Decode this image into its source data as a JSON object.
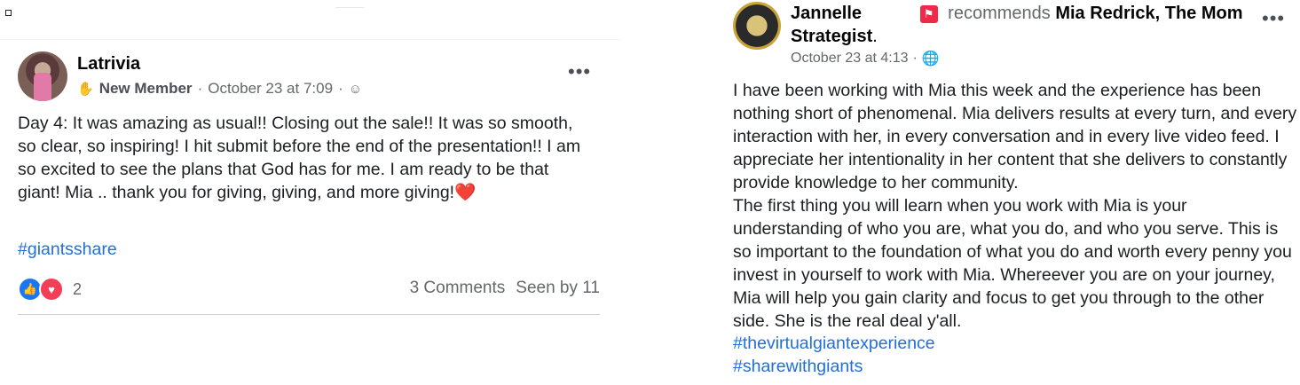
{
  "left_post": {
    "author": "Latrivia",
    "member_badge": "New Member",
    "meta_date": "October 23 at 7:09",
    "meta_separator": "·",
    "more_label": "•••",
    "body": "Day 4: It was amazing as usual!! Closing out the sale!! It was so smooth, so clear, so inspiring! I hit submit before the end of the presentation!! I am so excited to see the plans that God has for me. I am ready to be that giant! Mia .. thank you for giving, giving, and more giving!",
    "body_emoji": "❤️",
    "hashtag": "#giantsshare",
    "reaction_count": "2",
    "comments": "3 Comments",
    "seen_by": "Seen by 11",
    "icons": [
      "hand-badge-icon",
      "group-audience-icon",
      "like-reaction-icon",
      "love-reaction-icon",
      "more-options-icon"
    ]
  },
  "right_post": {
    "author": "Jannelle",
    "recommend_verb": "recommends",
    "recommend_target": "Mia Redrick, The Mom Strategist",
    "recommend_period": ".",
    "meta_date": "October 23 at 4:13",
    "meta_separator": "·",
    "more_label": "•••",
    "paragraph_1": "I have been working with Mia this week and the experience has been nothing short of phenomenal. Mia delivers results at every turn, and every interaction with her, in every conversation and in every live video feed. I appreciate her intentionality in her content that she delivers to constantly provide knowledge to her community.",
    "paragraph_2": "The first thing you will learn when you work with Mia is your understanding of who you are, what you do, and who you serve. This is so important to the foundation of what you do and worth every penny you invest in yourself to work with Mia. Whereever you are on your journey, Mia will help you gain clarity and focus to get you through to the other side. She is the real deal y'all.",
    "hashtags": [
      "#thevirtualgiantexperience",
      "#sharewithgiants"
    ],
    "icons": [
      "recommend-flag-icon",
      "globe-icon",
      "more-options-icon"
    ]
  },
  "colors": {
    "link": "#216fdb",
    "meta_gray": "#65676b",
    "like_blue": "#1877f2",
    "love_red": "#f33e58",
    "recommend_red": "#f02849"
  }
}
